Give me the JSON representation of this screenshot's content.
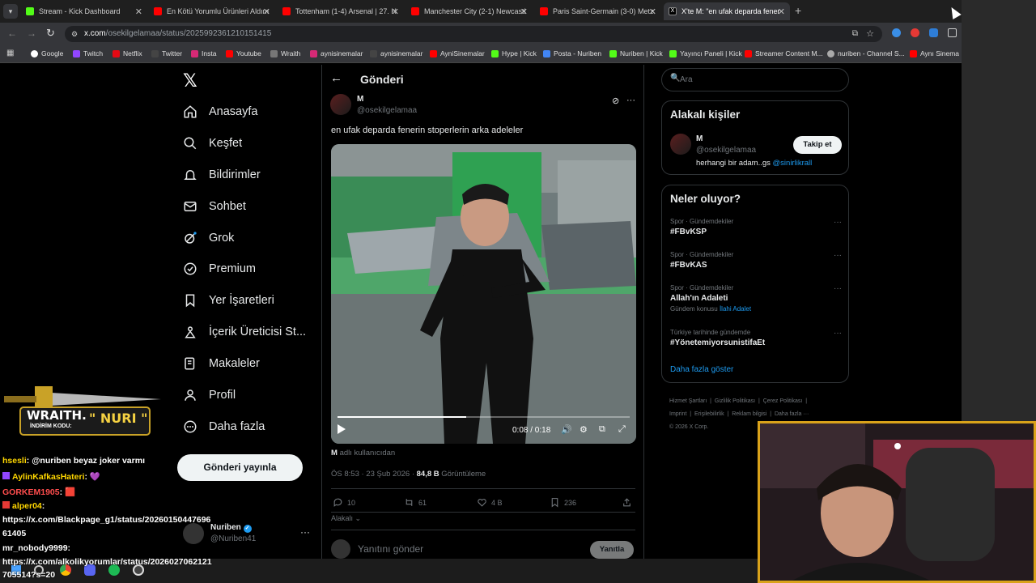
{
  "tabs": [
    {
      "label": "Stream - Kick Dashboard",
      "color": "#53fc18"
    },
    {
      "label": "En Kötü Yorumlu Ürünleri Aldım",
      "color": "#ff0000"
    },
    {
      "label": "Tottenham (1-4) Arsenal | 27. H",
      "color": "#ff0000"
    },
    {
      "label": "Manchester City (2-1) Newcastl",
      "color": "#ff0000"
    },
    {
      "label": "Paris Saint-Germain (3-0) Metz",
      "color": "#ff0000"
    },
    {
      "label": "X'te M: \"en ufak deparda fener",
      "color": "#ffffff"
    }
  ],
  "url": {
    "domain": "x.com",
    "path": "/osekilgelamaa/status/2025992361210151415"
  },
  "bookmarks": [
    "Google",
    "Twitch",
    "Netflix",
    "Twitter",
    "Insta",
    "Youtube",
    "Wraith",
    "aynisinemalar",
    "aynisinemalar",
    "AyniSinemalar",
    "Hype | Kick",
    "Posta - Nuriben",
    "Nuriben | Kick",
    "Yayıncı Paneli | Kick",
    "Streamer Content M...",
    "nuriben - Channel S...",
    "Aynı Sinema"
  ],
  "nav": [
    "Anasayfa",
    "Keşfet",
    "Bildirimler",
    "Sohbet",
    "Grok",
    "Premium",
    "Yer İşaretleri",
    "İçerik Üreticisi St...",
    "Makaleler",
    "Profil",
    "Daha fazla"
  ],
  "post_button": "Gönderi yayınla",
  "account": {
    "name": "Nuriben",
    "handle": "@Nuriben41"
  },
  "header_title": "Gönderi",
  "tweet": {
    "author": "M",
    "handle": "@osekilgelamaa",
    "text": "en ufak deparda fenerin stoperlerin arka adeleler",
    "video_time": "0:08 / 0:18",
    "video_progress": 0.44,
    "attribution_user": "M",
    "attribution_rest": "adlı kullanıcıdan",
    "timestamp": "ÖS 8:53 · 23 Şub 2026 ·",
    "views_count": "84,8 B",
    "views_label": "Görüntüleme",
    "replies": "10",
    "reposts": "61",
    "likes": "4 B",
    "bookmarks": "236",
    "relevance": "Alakalı",
    "reply_placeholder": "Yanıtını gönder",
    "reply_button": "Yanıtla"
  },
  "search_placeholder": "Ara",
  "relevant": {
    "title": "Alakalı kişiler",
    "name": "M",
    "handle": "@osekilgelamaa",
    "bio": "herhangi bir adam..gs",
    "bio_link": "@sinirlikrall",
    "follow": "Takip et"
  },
  "trends": {
    "title": "Neler oluyor?",
    "items": [
      {
        "category": "Spor · Gündemdekiler",
        "name": "#FBvKSP",
        "extra": "",
        "extra_link": ""
      },
      {
        "category": "Spor · Gündemdekiler",
        "name": "#FBvKAS",
        "extra": "",
        "extra_link": ""
      },
      {
        "category": "Spor · Gündemdekiler",
        "name": "Allah'ın Adaleti",
        "extra": "Gündem konusu",
        "extra_link": "İlahi Adalet"
      },
      {
        "category": "Türkiye tarihinde gündemde",
        "name": "#YönetemiyorsunistifaEt",
        "extra": "",
        "extra_link": ""
      }
    ],
    "show_more": "Daha fazla göster"
  },
  "footer": [
    "Hizmet Şartları",
    "Gizlilik Politikası",
    "Çerez Politikası",
    "Imprint",
    "Erişilebilirlik",
    "Reklam bilgisi",
    "Daha fazla ···"
  ],
  "copyright": "© 2026 X Corp.",
  "overlay": {
    "brand": "WRAITH.",
    "promo_label": "İNDİRİM KODU:",
    "promo_code": "\" NURI \""
  },
  "chat": [
    {
      "user": "hsesli",
      "color": "#ffd700",
      "msg": ": @nuriben beyaz joker varmı"
    },
    {
      "user": "AylinKafkasHateri",
      "color": "#ffd700",
      "msg": ": 💜"
    },
    {
      "user": "GORKEM1905",
      "color": "#ff4d4d",
      "msg": ": 🟥"
    },
    {
      "user": "alper04",
      "color": "#ffd700",
      "msg": ":"
    },
    {
      "user": "",
      "color": "#fff",
      "msg": "https://x.com/Blackpage_g1/status/20260150447696"
    },
    {
      "user": "",
      "color": "#fff",
      "msg": "61405"
    },
    {
      "user": "mr_nobody9999",
      "color": "#ffffff",
      "msg": ":"
    },
    {
      "user": "",
      "color": "#fff",
      "msg": "https://x.com/alkolikyorumlar/status/2026027062121"
    },
    {
      "user": "",
      "color": "#fff",
      "msg": "705514?s=20"
    }
  ]
}
